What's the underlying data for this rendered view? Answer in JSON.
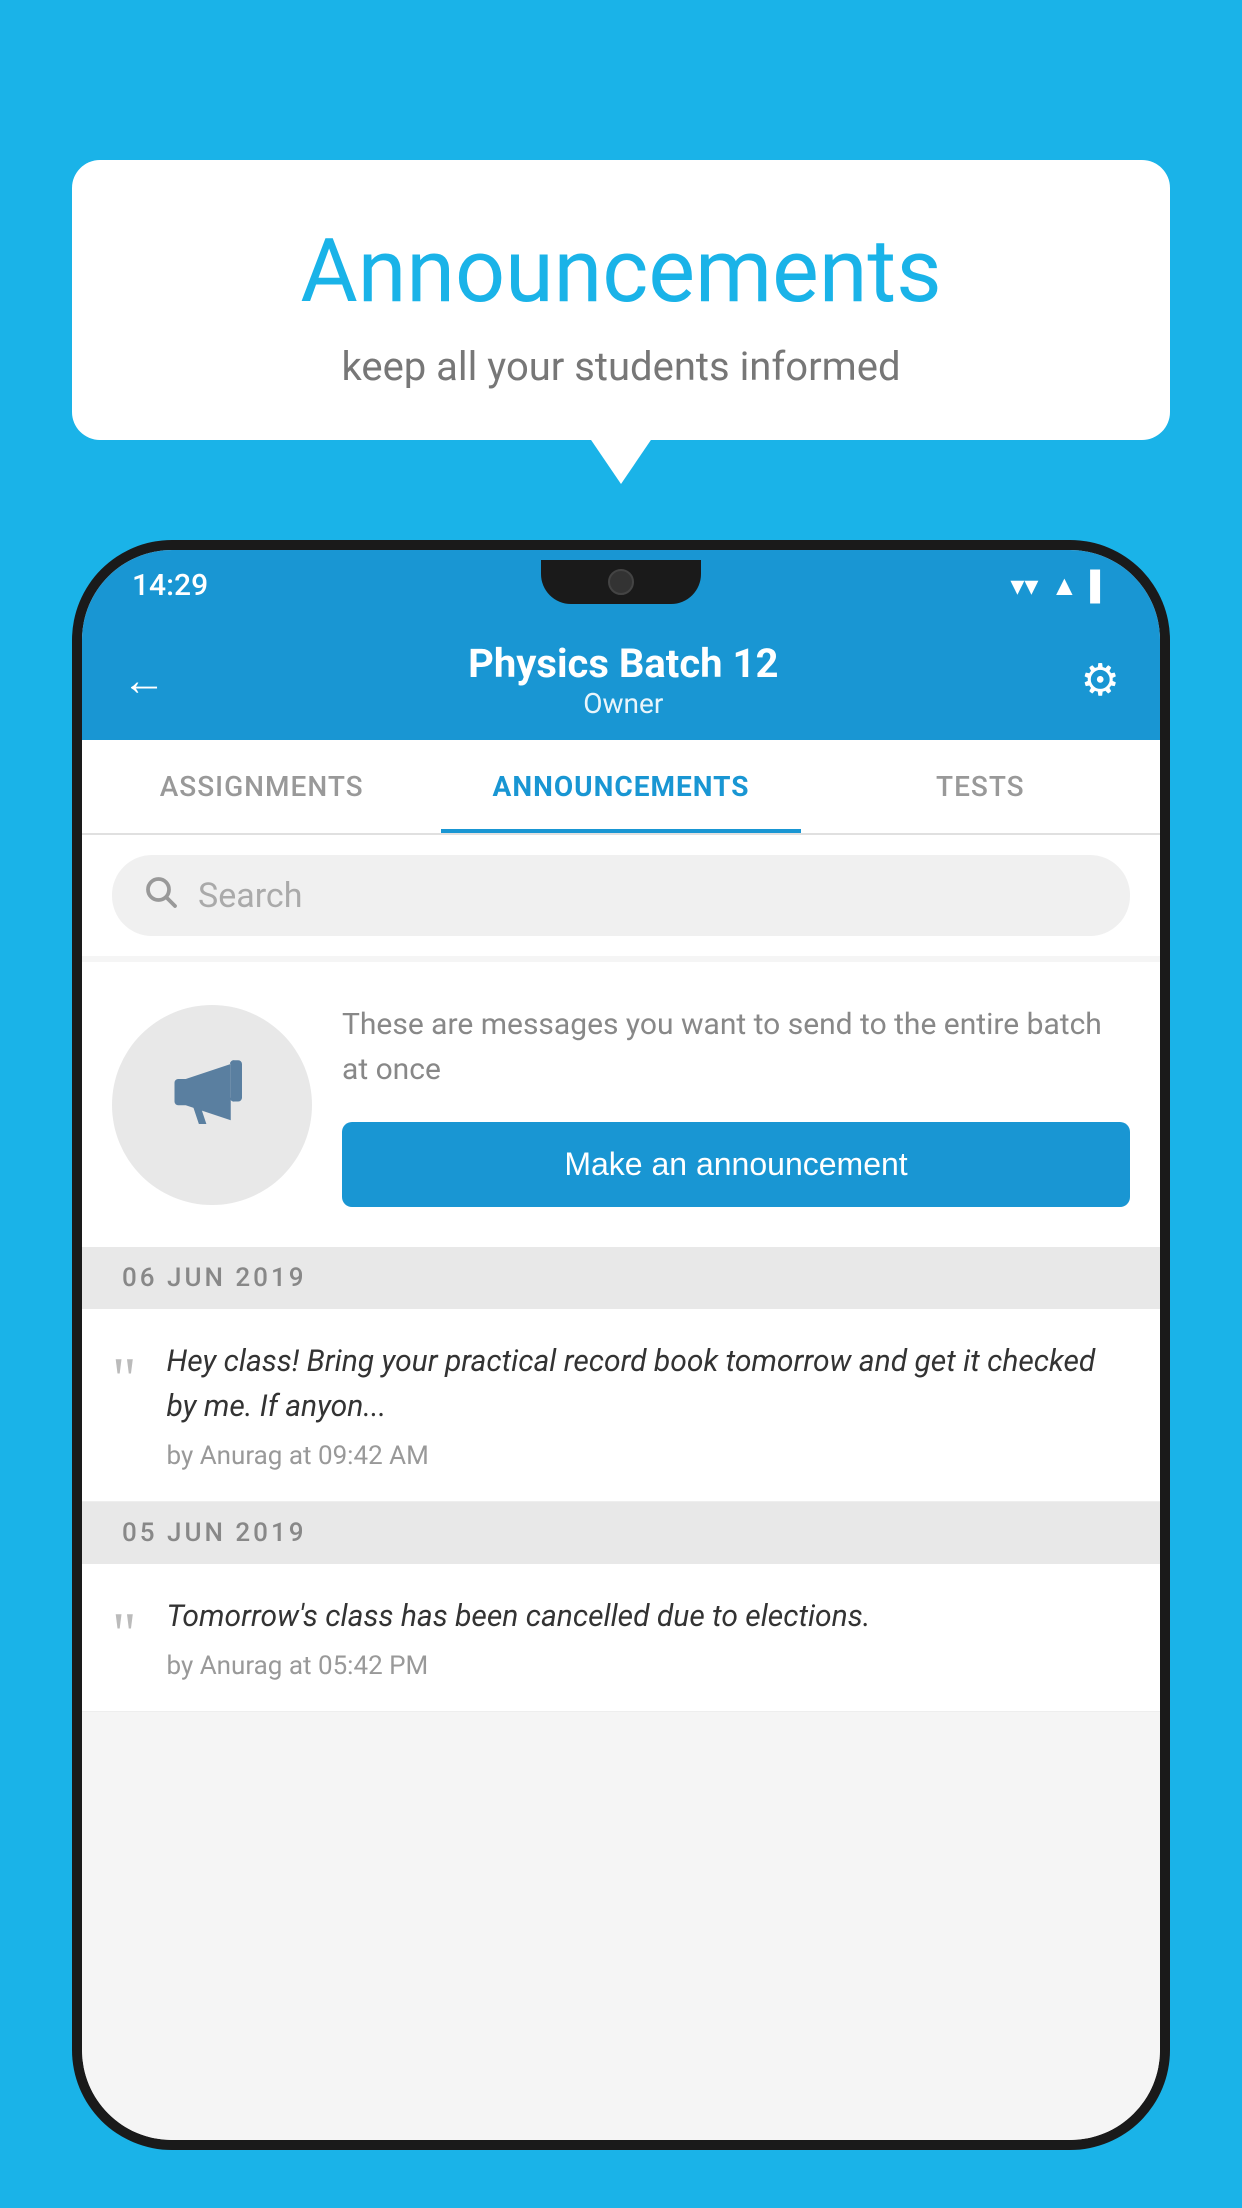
{
  "background_color": "#1ab3e8",
  "speech_bubble": {
    "title": "Announcements",
    "subtitle": "keep all your students informed"
  },
  "phone": {
    "status_bar": {
      "time": "14:29",
      "wifi_icon": "wifi",
      "signal_icon": "signal",
      "battery_icon": "battery"
    },
    "app_bar": {
      "back_icon": "←",
      "title": "Physics Batch 12",
      "subtitle": "Owner",
      "settings_icon": "⚙"
    },
    "tabs": [
      {
        "label": "ASSIGNMENTS",
        "active": false
      },
      {
        "label": "ANNOUNCEMENTS",
        "active": true
      },
      {
        "label": "TESTS",
        "active": false
      },
      {
        "label": "...",
        "active": false
      }
    ],
    "search": {
      "placeholder": "Search"
    },
    "cta": {
      "description": "These are messages you want to send to the entire batch at once",
      "button_label": "Make an announcement"
    },
    "announcements": [
      {
        "date": "06  JUN  2019",
        "text": "Hey class! Bring your practical record book tomorrow and get it checked by me. If anyon...",
        "meta": "by Anurag at 09:42 AM"
      },
      {
        "date": "05  JUN  2019",
        "text": "Tomorrow's class has been cancelled due to elections.",
        "meta": "by Anurag at 05:42 PM"
      }
    ]
  }
}
